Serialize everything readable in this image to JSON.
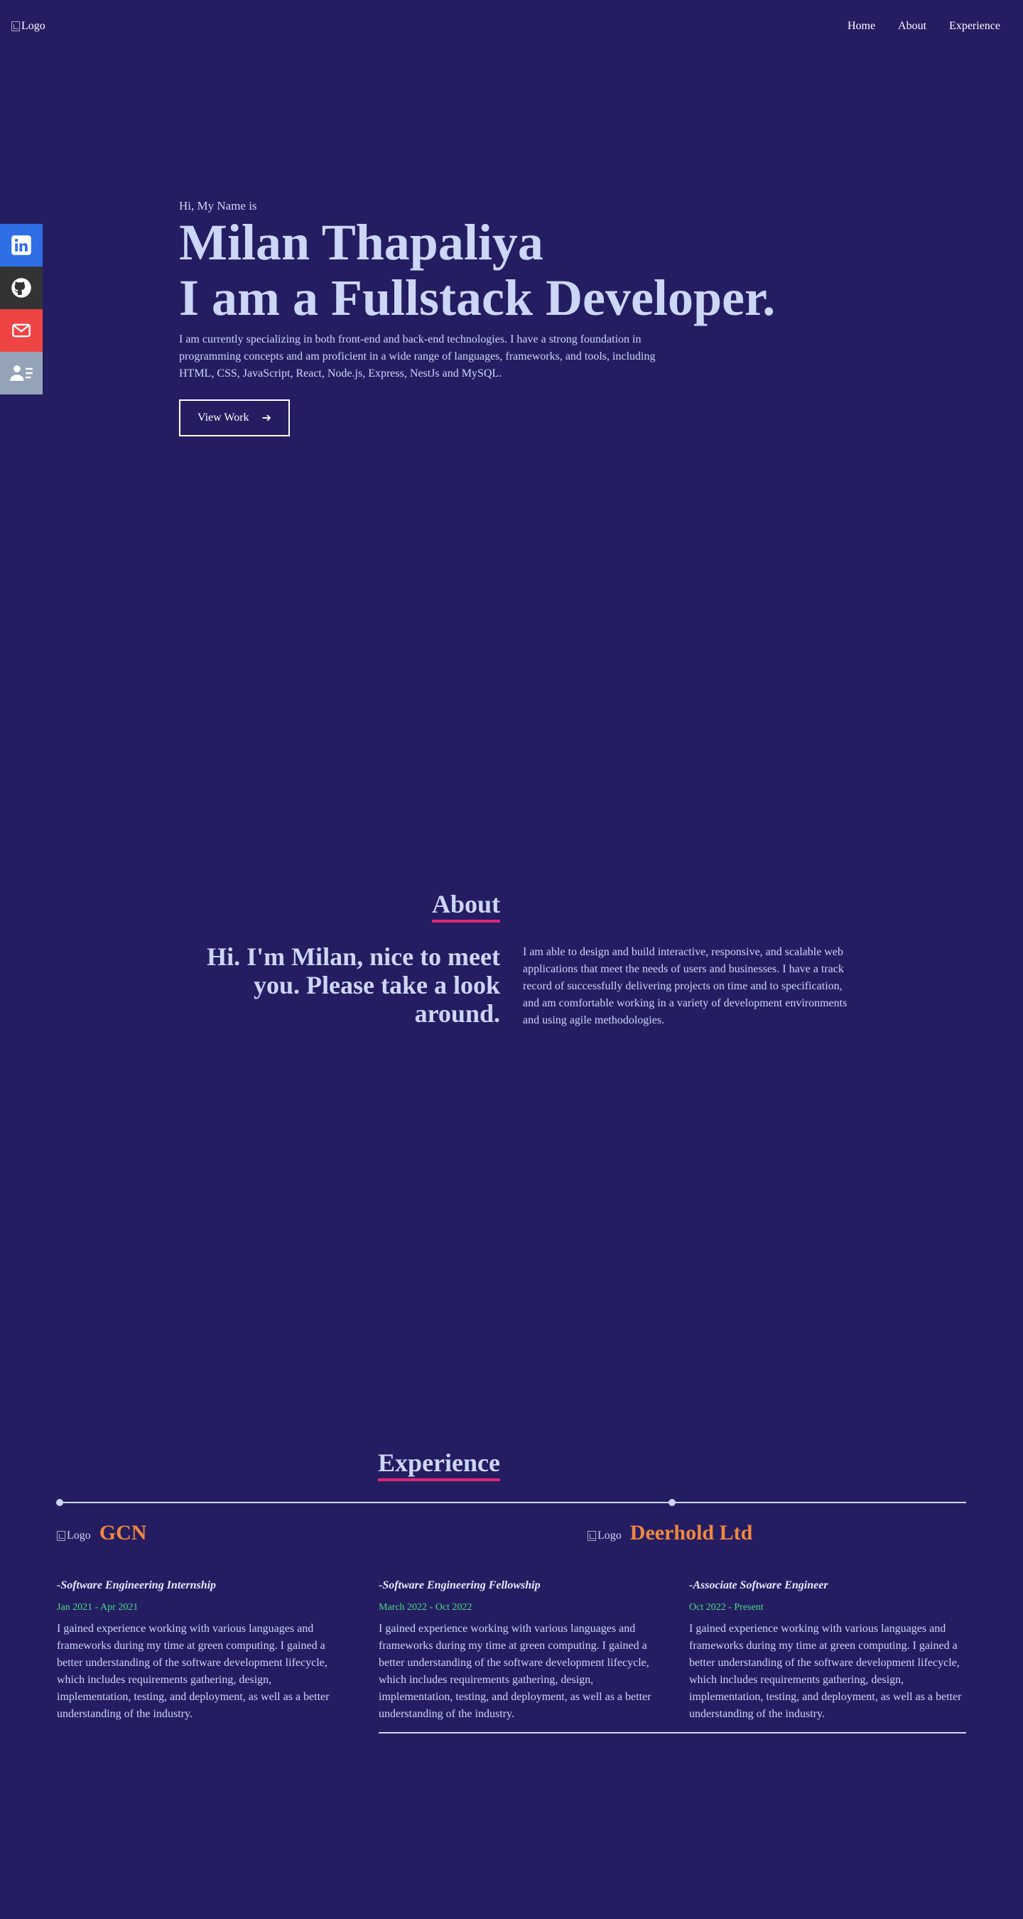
{
  "nav": {
    "logo_alt": "Logo",
    "links": [
      "Home",
      "About",
      "Experience"
    ]
  },
  "social": {
    "items": [
      "linkedin-icon",
      "github-icon",
      "mail-icon",
      "resume-icon"
    ],
    "colors": [
      "#2f6fe6",
      "#333333",
      "#ef4444",
      "#94a3b8"
    ]
  },
  "hero": {
    "greeting": "Hi, My Name is",
    "name": "Milan Thapaliya",
    "tagline": "I am a Fullstack Developer.",
    "intro": "I am currently specializing in both front-end and back-end technologies. I have a strong foundation in programming concepts and am proficient in a wide range of languages, frameworks, and tools, including HTML, CSS, JavaScript, React, Node.js, Express, NestJs and MySQL.",
    "button_label": "View Work",
    "button_arrow": "➔"
  },
  "about": {
    "title": "About",
    "heading": "Hi. I'm Milan, nice to meet you. Please take a look around.",
    "text": "I am able to design and build interactive, responsive, and scalable web applications that meet the needs of users and businesses. I have a track record of successfully delivering projects on time and to specification, and am comfortable working in a variety of development environments and using agile methodologies."
  },
  "experience": {
    "title": "Experience",
    "companies": [
      {
        "logo_alt": "Logo",
        "name": "GCN"
      },
      {
        "logo_alt": "Logo",
        "name": "Deerhold Ltd"
      }
    ],
    "jobs": [
      {
        "role": "-Software Engineering Internship",
        "dates": "Jan 2021 - Apr 2021",
        "desc": "I gained experience working with various languages and frameworks during my time at green computing. I gained a better understanding of the software development lifecycle, which includes requirements gathering, design, implementation, testing, and deployment, as well as a better understanding of the industry."
      },
      {
        "role": "-Software Engineering Fellowship",
        "dates": "March 2022 - Oct 2022",
        "desc": "I gained experience working with various languages and frameworks during my time at green computing. I gained a better understanding of the software development lifecycle, which includes requirements gathering, design, implementation, testing, and deployment, as well as a better understanding of the industry."
      },
      {
        "role": "-Associate Software Engineer",
        "dates": "Oct 2022 - Present",
        "desc": "I gained experience working with various languages and frameworks during my time at green computing. I gained a better understanding of the software development lifecycle, which includes requirements gathering, design, implementation, testing, and deployment, as well as a better understanding of the industry."
      }
    ]
  },
  "colors": {
    "background": "#251d62",
    "text": "#ccd6f6",
    "accent_underline": "#db2777",
    "company": "#f0883e",
    "dates": "#4ade80"
  }
}
